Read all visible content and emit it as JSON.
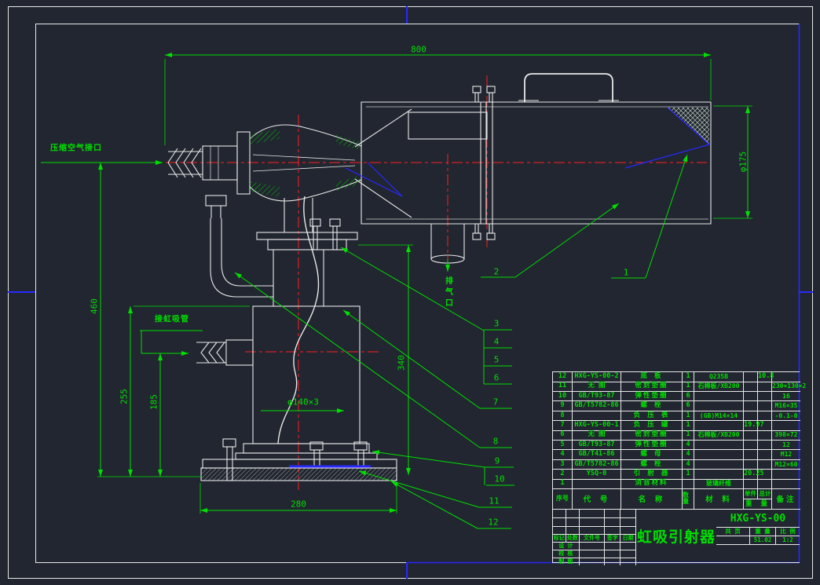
{
  "colors": {
    "background": "#212630",
    "green": "#00df00",
    "red": "#ff1f1f",
    "blue": "#2929ff",
    "white": "#e8e8e8"
  },
  "drawing": {
    "labels": {
      "air_inlet": "压缩空气接口",
      "siphon_pipe": "接虹吸管",
      "exhaust_port": "排气口"
    },
    "dims": {
      "top_width": "800",
      "tank_diameter": "φ175",
      "total_height": "460",
      "mid_height": "255",
      "low_height": "185",
      "body_height": "340",
      "pipe_spec": "φ140×3",
      "base_width": "280"
    },
    "callouts": [
      "1",
      "2",
      "3",
      "4",
      "5",
      "6",
      "7",
      "8",
      "9",
      "10",
      "11",
      "12"
    ]
  },
  "bom": {
    "col_headers": {
      "no": "序号",
      "code": "代 号",
      "name": "名 称",
      "qty": "数量",
      "material": "材 料",
      "unit": "单件",
      "total": "总计",
      "weight": "重 量",
      "remark": "备注"
    },
    "rows": [
      {
        "no": "12",
        "code": "HXG-YS-00-2",
        "name": "底 板",
        "qty": "1",
        "material": "Q235B",
        "unit_weight": "",
        "total_weight": "10.8",
        "remark": ""
      },
      {
        "no": "11",
        "code": "无 图",
        "name": "密封垫圈",
        "qty": "1",
        "material": "石棉板/XB200",
        "unit_weight": "",
        "total_weight": "",
        "remark": "230×130×2"
      },
      {
        "no": "10",
        "code": "GB/T93-87",
        "name": "弹性垫圈",
        "qty": "6",
        "material": "",
        "unit_weight": "",
        "total_weight": "",
        "remark": "16"
      },
      {
        "no": "9",
        "code": "GB/T5782-86",
        "name": "螺 栓",
        "qty": "6",
        "material": "",
        "unit_weight": "",
        "total_weight": "",
        "remark": "M16×35"
      },
      {
        "no": "8",
        "code": "",
        "name": "负 压 表",
        "qty": "1",
        "material": "(GB)M14×14",
        "unit_weight": "",
        "total_weight": "",
        "remark": "-0.1-0"
      },
      {
        "no": "7",
        "code": "HXG-YS-00-1",
        "name": "负 压 罐",
        "qty": "1",
        "material": "",
        "unit_weight": "19.97",
        "total_weight": "",
        "remark": ""
      },
      {
        "no": "6",
        "code": "无 图",
        "name": "密封垫圈",
        "qty": "1",
        "material": "石棉板/XB200",
        "unit_weight": "",
        "total_weight": "",
        "remark": "398×72"
      },
      {
        "no": "5",
        "code": "GB/T93-87",
        "name": "弹性垫圈",
        "qty": "4",
        "material": "",
        "unit_weight": "",
        "total_weight": "",
        "remark": "12"
      },
      {
        "no": "4",
        "code": "GB/T41-86",
        "name": "螺 母",
        "qty": "4",
        "material": "",
        "unit_weight": "",
        "total_weight": "",
        "remark": "M12"
      },
      {
        "no": "3",
        "code": "GB/T5782-86",
        "name": "螺 栓",
        "qty": "4",
        "material": "",
        "unit_weight": "",
        "total_weight": "",
        "remark": "M12×60"
      },
      {
        "no": "2",
        "code": "YSQ-0",
        "name": "引 射 器",
        "qty": "1",
        "material": "",
        "unit_weight": "20.25",
        "total_weight": "",
        "remark": ""
      },
      {
        "no": "1",
        "code": "",
        "name": "消音材料",
        "qty": "",
        "material": "玻璃纤维",
        "unit_weight": "",
        "total_weight": "",
        "remark": ""
      }
    ]
  },
  "title_block": {
    "product_title": "虹吸引射器",
    "drawing_no": "HXG-YS-00",
    "rev_headers": [
      "标记",
      "处数",
      "文件号",
      "签字",
      "日期"
    ],
    "sign_rows": [
      "设 计",
      "校 核",
      "制 图"
    ],
    "info_headers": [
      "共 页",
      "重 量",
      "比 例"
    ],
    "info_values": [
      "",
      "51.02",
      "1:2"
    ]
  }
}
